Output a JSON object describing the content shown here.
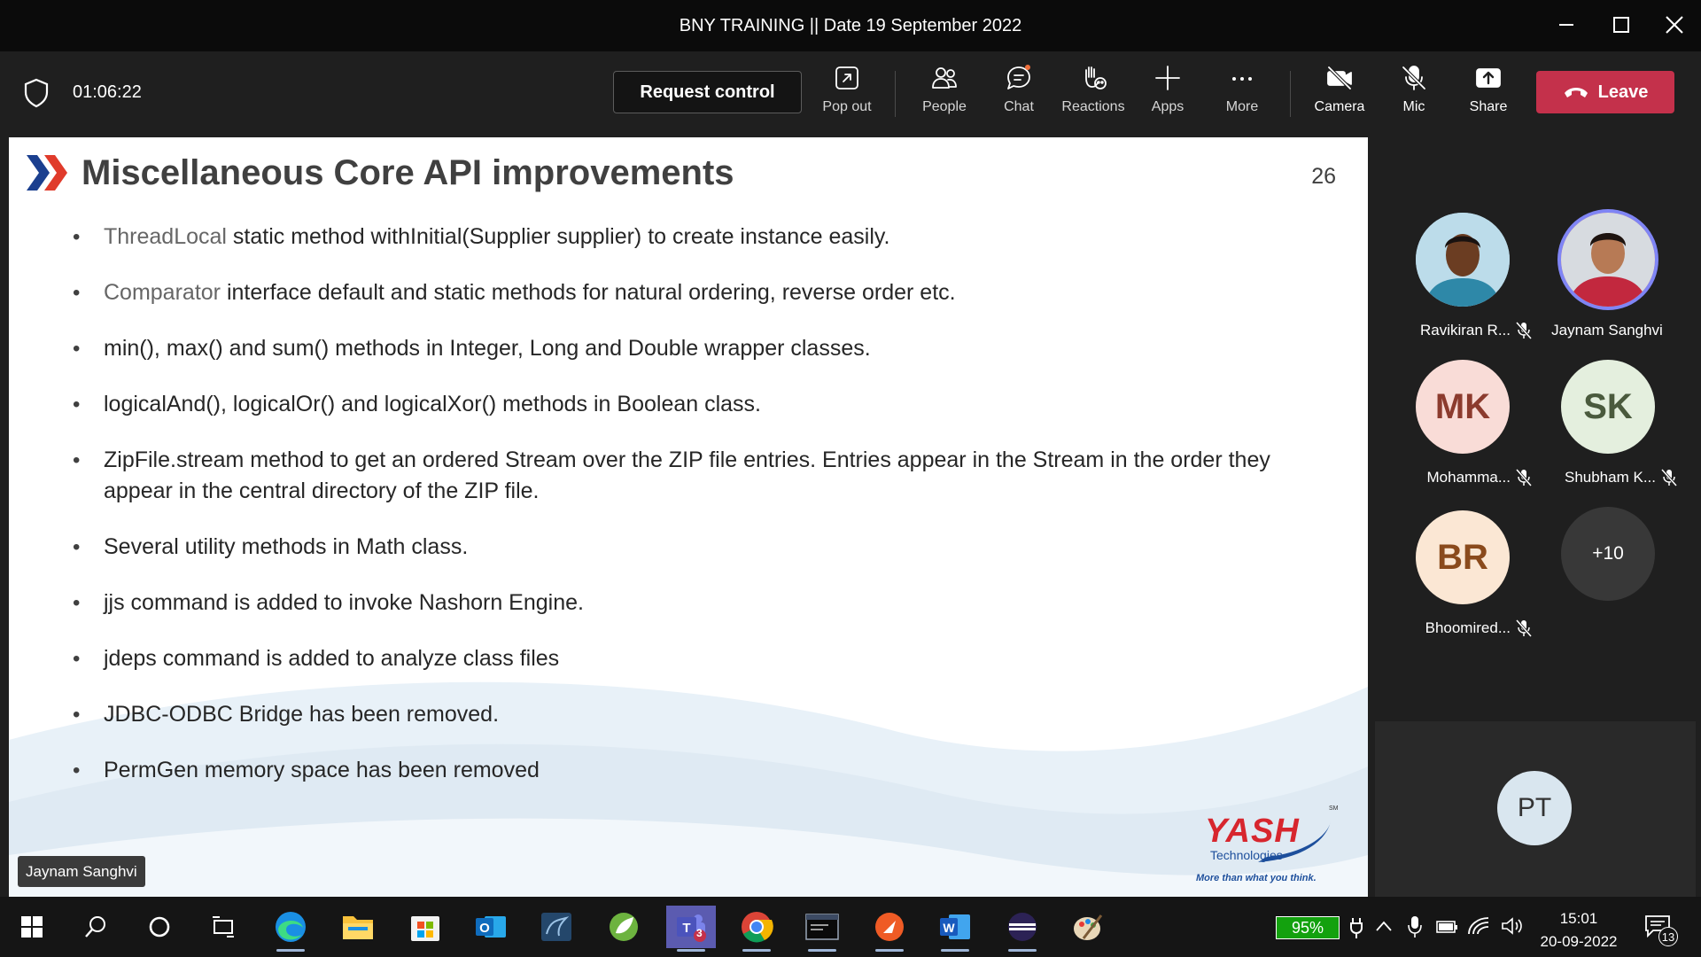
{
  "window": {
    "title": "BNY TRAINING || Date 19 September 2022"
  },
  "toolbar": {
    "timer": "01:06:22",
    "request_control": "Request control",
    "buttons": {
      "pop_out": "Pop out",
      "people": "People",
      "chat": "Chat",
      "reactions": "Reactions",
      "apps": "Apps",
      "more": "More",
      "camera": "Camera",
      "mic": "Mic",
      "share": "Share"
    },
    "leave": "Leave"
  },
  "slide": {
    "title": "Miscellaneous Core API improvements",
    "page_number": "26",
    "bullets": [
      {
        "highlight": "ThreadLocal",
        "text": " static method withInitial(Supplier supplier) to create instance easily."
      },
      {
        "highlight": "Comparator",
        "text": "  interface default and static methods for natural ordering, reverse order etc."
      },
      {
        "highlight": "",
        "text": "min(), max() and sum() methods in Integer, Long and Double wrapper classes."
      },
      {
        "highlight": "",
        "text": "logicalAnd(), logicalOr() and logicalXor() methods in Boolean class."
      },
      {
        "highlight": "",
        "text": "ZipFile.stream method to get an ordered Stream over the ZIP file entries. Entries appear in the Stream in the order they appear in the central directory of the ZIP file."
      },
      {
        "highlight": "",
        "text": "Several utility methods in Math class."
      },
      {
        "highlight": "",
        "text": "jjs command is added to invoke Nashorn Engine."
      },
      {
        "highlight": "",
        "text": "jdeps command is added to analyze class files"
      },
      {
        "highlight": "",
        "text": "JDBC-ODBC Bridge has been removed."
      },
      {
        "highlight": "",
        "text": "PermGen memory space has been removed"
      }
    ],
    "logo": {
      "name": "YASH",
      "sub": "Technologies",
      "tagline": "More than what you think.",
      "sm": "SM"
    },
    "presenter_chip": "Jaynam Sanghvi"
  },
  "participants": [
    {
      "name": "Ravikiran R...",
      "initials": "",
      "muted": true,
      "photo": true
    },
    {
      "name": "Jaynam Sanghvi",
      "initials": "",
      "muted": false,
      "photo": true,
      "speaking": true
    },
    {
      "name": "Mohamma...",
      "initials": "MK",
      "muted": true,
      "bg": "#f9dcd7",
      "fg": "#8c3b2e"
    },
    {
      "name": "Shubham K...",
      "initials": "SK",
      "muted": true,
      "bg": "#e4efde",
      "fg": "#4a5a3d"
    },
    {
      "name": "Bhoomired...",
      "initials": "BR",
      "muted": true,
      "bg": "#fbe7d4",
      "fg": "#8a4a1c"
    }
  ],
  "more_participants": "+10",
  "self_tile": {
    "initials": "PT"
  },
  "taskbar": {
    "teams_badge": "3",
    "battery": "95%",
    "time": "15:01",
    "date": "20-09-2022",
    "notifications": "13"
  },
  "colors": {
    "accent": "#7f85f5",
    "leave": "#c4314b",
    "battery": "#13a10e"
  }
}
